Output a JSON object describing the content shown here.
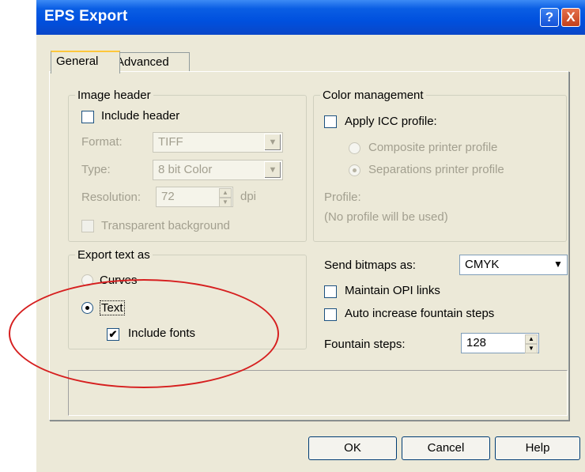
{
  "window": {
    "title": "EPS Export",
    "help_btn": "?",
    "close_btn": "X"
  },
  "tabs": [
    {
      "label": "General",
      "active": true
    },
    {
      "label": "Advanced",
      "active": false
    }
  ],
  "image_header": {
    "legend": "Image header",
    "include_header": {
      "label": "Include header",
      "checked": false
    },
    "format": {
      "label": "Format:",
      "value": "TIFF"
    },
    "type": {
      "label": "Type:",
      "value": "8 bit Color"
    },
    "resolution": {
      "label": "Resolution:",
      "value": "72",
      "unit": "dpi"
    },
    "transparent_bg": {
      "label": "Transparent background",
      "checked": false
    }
  },
  "color_management": {
    "legend": "Color management",
    "apply_icc": {
      "label": "Apply ICC profile:",
      "checked": false
    },
    "composite": {
      "label": "Composite printer profile",
      "selected": false
    },
    "separations": {
      "label": "Separations printer profile",
      "selected": true
    },
    "profile_label": "Profile:",
    "profile_value": "(No profile will be used)"
  },
  "export_text": {
    "legend": "Export text as",
    "curves": {
      "label": "Curves",
      "selected": false
    },
    "text": {
      "label": "Text",
      "selected": true
    },
    "include_fonts": {
      "label": "Include fonts",
      "checked": true
    }
  },
  "bitmaps": {
    "send_label": "Send bitmaps as:",
    "send_value": "CMYK",
    "maintain_opi": {
      "label": "Maintain OPI links",
      "checked": false
    },
    "auto_fountain": {
      "label": "Auto increase fountain steps",
      "checked": false
    },
    "fountain_label": "Fountain steps:",
    "fountain_value": "128"
  },
  "buttons": {
    "ok": "OK",
    "cancel": "Cancel",
    "help": "Help"
  },
  "colors": {
    "annotation": "#d61f1f",
    "titlebar": "#0050de",
    "dialog_bg": "#ece9d8"
  }
}
